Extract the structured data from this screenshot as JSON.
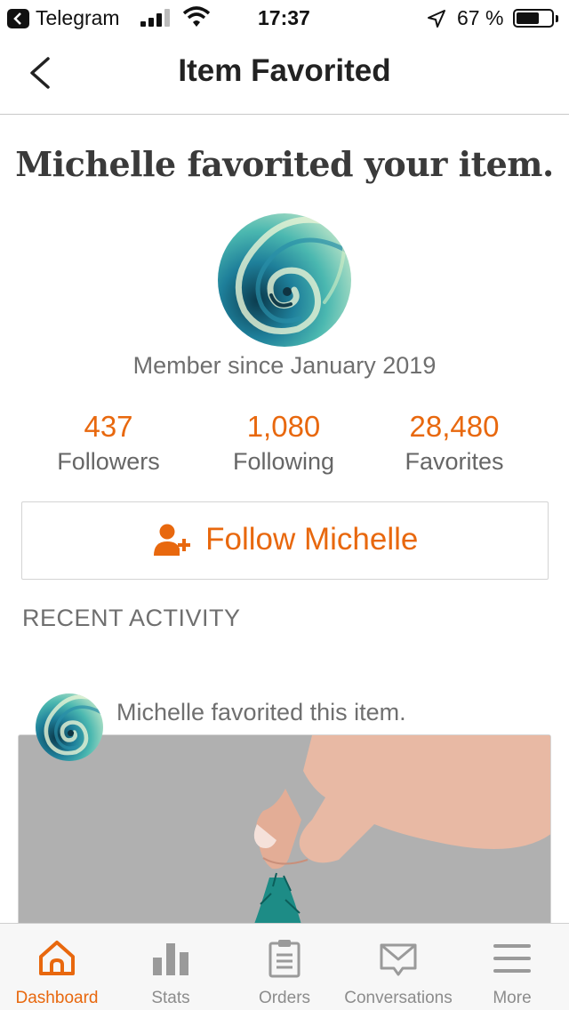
{
  "status_bar": {
    "back_app": "Telegram",
    "time": "17:37",
    "battery": "67 %",
    "battery_level": 0.67
  },
  "nav": {
    "title": "Item Favorited"
  },
  "headline": "Michelle favorited your item.",
  "profile": {
    "member_since": "Member since January 2019",
    "stats": [
      {
        "value": "437",
        "label": "Followers"
      },
      {
        "value": "1,080",
        "label": "Following"
      },
      {
        "value": "28,480",
        "label": "Favorites"
      }
    ],
    "follow_button": "Follow Michelle"
  },
  "recent_activity": {
    "title": "RECENT ACTIVITY",
    "items": [
      {
        "text": "Michelle favorited this item."
      }
    ]
  },
  "tabbar": {
    "tabs": [
      {
        "label": "Dashboard",
        "icon": "home-icon",
        "active": true
      },
      {
        "label": "Stats",
        "icon": "bar-chart-icon",
        "active": false
      },
      {
        "label": "Orders",
        "icon": "clipboard-icon",
        "active": false
      },
      {
        "label": "Conversations",
        "icon": "envelope-icon",
        "active": false
      },
      {
        "label": "More",
        "icon": "menu-icon",
        "active": false
      }
    ]
  },
  "colors": {
    "accent": "#e8680e",
    "muted_text": "#6f6f6f"
  }
}
